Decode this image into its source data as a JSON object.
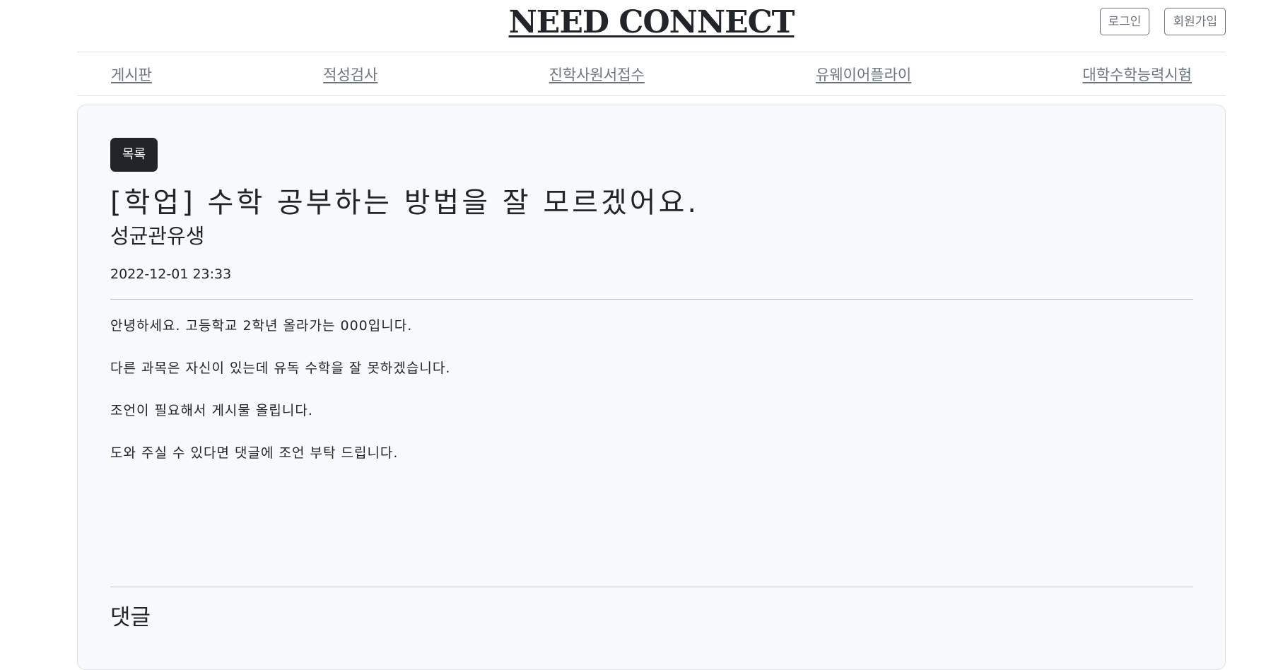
{
  "header": {
    "logo": "NEED CONNECT",
    "login_label": "로그인",
    "signup_label": "회원가입"
  },
  "nav": {
    "items": [
      {
        "label": "게시판"
      },
      {
        "label": "적성검사"
      },
      {
        "label": "진학사원서접수"
      },
      {
        "label": "유웨이어플라이"
      },
      {
        "label": "대학수학능력시험"
      }
    ]
  },
  "post": {
    "list_button": "목록",
    "title": "[학업] 수학 공부하는 방법을 잘 모르겠어요.",
    "author": "성균관유생",
    "date": "2022-12-01 23:33",
    "body": [
      "안녕하세요. 고등학교 2학년 올라가는 000입니다.",
      "다른 과목은 자신이 있는데 유독 수학을 잘 못하겠습니다.",
      "조언이 필요해서 게시물 올립니다.",
      "도와 주실 수 있다면 댓글에 조언 부탁 드립니다."
    ]
  },
  "comments": {
    "title": "댓글"
  },
  "colors": {
    "primary_dark": "#212529",
    "muted": "#6c757d",
    "card_bg": "#f8f9fa",
    "border": "#dee2e6"
  }
}
